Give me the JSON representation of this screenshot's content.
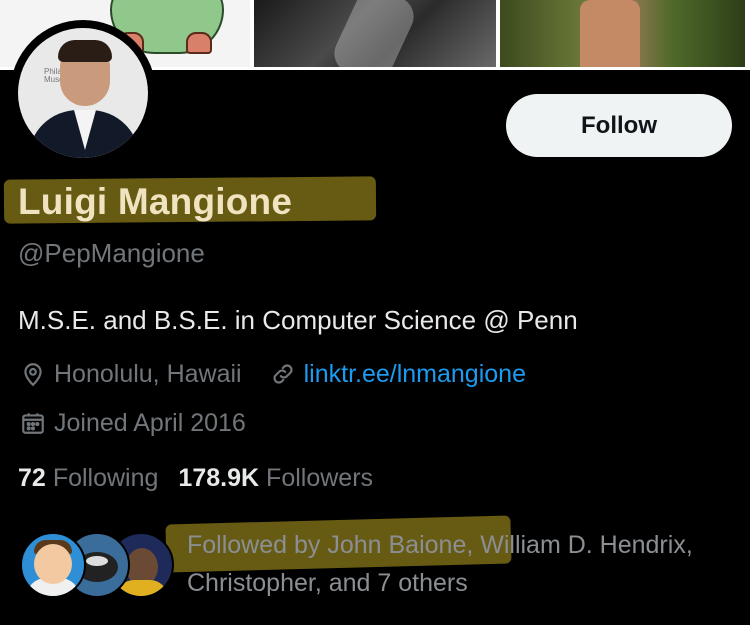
{
  "profile": {
    "name": "Luigi Mangione",
    "handle": "@PepMangione",
    "bio": "M.S.E. and B.S.E. in Computer Science @ Penn",
    "location": "Honolulu, Hawaii",
    "link": "linktr.ee/lnmangione",
    "joined": "Joined April 2016",
    "avatar_caption": "Phila\nMuse"
  },
  "actions": {
    "follow_label": "Follow"
  },
  "stats": {
    "following_count": "72",
    "following_label": "Following",
    "followers_count": "178.9K",
    "followers_label": "Followers"
  },
  "mutuals": {
    "followed_by_text": "Followed by John Baione, William D. Hendrix, Christopher, and 7 others"
  },
  "icons": {
    "location": "location-pin-icon",
    "link": "link-icon",
    "joined": "calendar-icon"
  },
  "colors": {
    "background": "#000000",
    "text_primary": "#e7e9ea",
    "text_secondary": "#71767b",
    "link": "#1d9bf0",
    "button_bg": "#eff3f4",
    "highlight": "#6d6015"
  }
}
